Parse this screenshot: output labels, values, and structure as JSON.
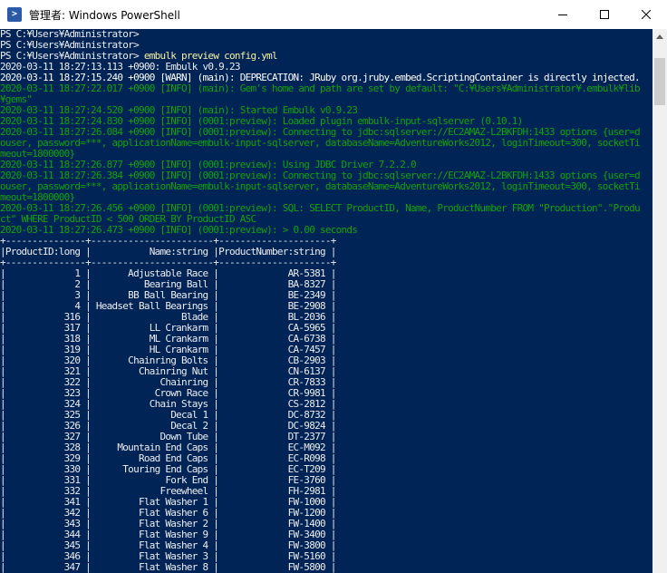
{
  "window": {
    "title": "管理者: Windows PowerShell",
    "icon_letter": ">"
  },
  "prompt": {
    "lines": [
      "PS C:¥Users¥Administrator>",
      "PS C:¥Users¥Administrator>"
    ],
    "prefix": "PS C:¥Users¥Administrator> ",
    "command": "embulk preview config.yml"
  },
  "log": [
    {
      "text": "2020-03-11 18:27:13.113 +0900: Embulk v0.9.23",
      "level": "plain"
    },
    {
      "text": "2020-03-11 18:27:15.240 +0900 [WARN] (main): DEPRECATION: JRuby org.jruby.embed.ScriptingContainer is directly injected.",
      "level": "warn"
    },
    {
      "text": "2020-03-11 18:27:22.017 +0900 [INFO] (main): Gem's home and path are set by default: \"C:¥Users¥Administrator¥.embulk¥lib",
      "level": "info"
    },
    {
      "text": "¥gems\"",
      "level": "info"
    },
    {
      "text": "2020-03-11 18:27:24.520 +0900 [INFO] (main): Started Embulk v0.9.23",
      "level": "info"
    },
    {
      "text": "2020-03-11 18:27:24.830 +0900 [INFO] (0001:preview): Loaded plugin embulk-input-sqlserver (0.10.1)",
      "level": "info"
    },
    {
      "text": "2020-03-11 18:27:26.084 +0900 [INFO] (0001:preview): Connecting to jdbc:sqlserver://EC2AMAZ-L2BKFDH:1433 options {user=d",
      "level": "info"
    },
    {
      "text": "ouser, password=***, applicationName=embulk-input-sqlserver, databaseName=AdventureWorks2012, loginTimeout=300, socketTi",
      "level": "info"
    },
    {
      "text": "meout=1800000}",
      "level": "info"
    },
    {
      "text": "2020-03-11 18:27:26.877 +0900 [INFO] (0001:preview): Using JDBC Driver 7.2.2.0",
      "level": "info"
    },
    {
      "text": "2020-03-11 18:27:26.384 +0900 [INFO] (0001:preview): Connecting to jdbc:sqlserver://EC2AMAZ-L2BKFDH:1433 options {user=d",
      "level": "info"
    },
    {
      "text": "ouser, password=***, applicationName=embulk-input-sqlserver, databaseName=AdventureWorks2012, loginTimeout=300, socketTi",
      "level": "info"
    },
    {
      "text": "meout=1800000}",
      "level": "info"
    },
    {
      "text": "2020-03-11 18:27:26.456 +0900 [INFO] (0001:preview): SQL: SELECT ProductID, Name, ProductNumber FROM \"Production\".\"Produ",
      "level": "info"
    },
    {
      "text": "ct\" WHERE ProductID < 500 ORDER BY ProductID ASC",
      "level": "info"
    },
    {
      "text": "2020-03-11 18:27:26.473 +0900 [INFO] (0001:preview): > 0.00 seconds",
      "level": "info"
    }
  ],
  "table": {
    "columns": [
      {
        "label": "ProductID:long",
        "width": 14
      },
      {
        "label": "Name:string",
        "width": 22
      },
      {
        "label": "ProductNumber:string",
        "width": 20
      }
    ],
    "rows": [
      [
        "1",
        "Adjustable Race",
        "AR-5381"
      ],
      [
        "2",
        "Bearing Ball",
        "BA-8327"
      ],
      [
        "3",
        "BB Ball Bearing",
        "BE-2349"
      ],
      [
        "4",
        "Headset Ball Bearings",
        "BE-2908"
      ],
      [
        "316",
        "Blade",
        "BL-2036"
      ],
      [
        "317",
        "LL Crankarm",
        "CA-5965"
      ],
      [
        "318",
        "ML Crankarm",
        "CA-6738"
      ],
      [
        "319",
        "HL Crankarm",
        "CA-7457"
      ],
      [
        "320",
        "Chainring Bolts",
        "CB-2903"
      ],
      [
        "321",
        "Chainring Nut",
        "CN-6137"
      ],
      [
        "322",
        "Chainring",
        "CR-7833"
      ],
      [
        "323",
        "Crown Race",
        "CR-9981"
      ],
      [
        "324",
        "Chain Stays",
        "CS-2812"
      ],
      [
        "325",
        "Decal 1",
        "DC-8732"
      ],
      [
        "326",
        "Decal 2",
        "DC-9824"
      ],
      [
        "327",
        "Down Tube",
        "DT-2377"
      ],
      [
        "328",
        "Mountain End Caps",
        "EC-M092"
      ],
      [
        "329",
        "Road End Caps",
        "EC-R098"
      ],
      [
        "330",
        "Touring End Caps",
        "EC-T209"
      ],
      [
        "331",
        "Fork End",
        "FE-3760"
      ],
      [
        "332",
        "Freewheel",
        "FH-2981"
      ],
      [
        "341",
        "Flat Washer 1",
        "FW-1000"
      ],
      [
        "342",
        "Flat Washer 6",
        "FW-1200"
      ],
      [
        "343",
        "Flat Washer 2",
        "FW-1400"
      ],
      [
        "344",
        "Flat Washer 9",
        "FW-3400"
      ],
      [
        "345",
        "Flat Washer 4",
        "FW-3800"
      ],
      [
        "346",
        "Flat Washer 3",
        "FW-5160"
      ],
      [
        "347",
        "Flat Washer 8",
        "FW-5800"
      ]
    ]
  },
  "colors": {
    "console_bg": "#012456",
    "text": "#eeedf0",
    "info": "#13a10e",
    "command": "#f9f1a5"
  }
}
